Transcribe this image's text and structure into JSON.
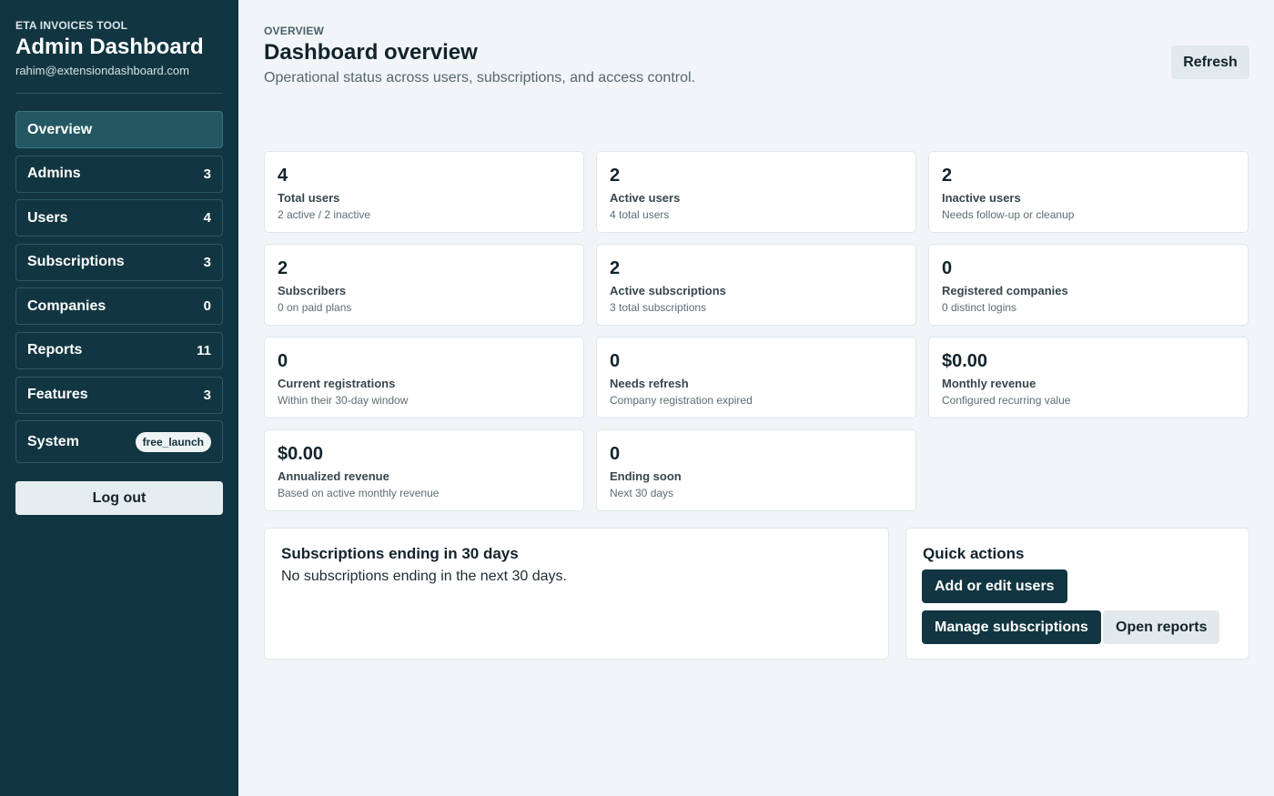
{
  "sidebar": {
    "kicker": "ETA INVOICES TOOL",
    "title": "Admin Dashboard",
    "email": "rahim@extensiondashboard.com",
    "nav": {
      "overview": {
        "label": "Overview"
      },
      "admins": {
        "label": "Admins",
        "count": "3"
      },
      "users": {
        "label": "Users",
        "count": "4"
      },
      "subscriptions": {
        "label": "Subscriptions",
        "count": "3"
      },
      "companies": {
        "label": "Companies",
        "count": "0"
      },
      "reports": {
        "label": "Reports",
        "count": "11"
      },
      "features": {
        "label": "Features",
        "count": "3"
      },
      "system": {
        "label": "System",
        "badge": "free_launch"
      }
    },
    "logout_label": "Log out"
  },
  "header": {
    "eyebrow": "OVERVIEW",
    "title": "Dashboard overview",
    "subtitle": "Operational status across users, subscriptions, and access control.",
    "refresh_label": "Refresh"
  },
  "stats": {
    "total_users": {
      "value": "4",
      "label": "Total users",
      "sub": "2 active / 2 inactive"
    },
    "active_users": {
      "value": "2",
      "label": "Active users",
      "sub": "4 total users"
    },
    "inactive_users": {
      "value": "2",
      "label": "Inactive users",
      "sub": "Needs follow-up or cleanup"
    },
    "subscribers": {
      "value": "2",
      "label": "Subscribers",
      "sub": "0 on paid plans"
    },
    "active_subscriptions": {
      "value": "2",
      "label": "Active subscriptions",
      "sub": "3 total subscriptions"
    },
    "registered_companies": {
      "value": "0",
      "label": "Registered companies",
      "sub": "0 distinct logins"
    },
    "current_registrations": {
      "value": "0",
      "label": "Current registrations",
      "sub": "Within their 30-day window"
    },
    "needs_refresh": {
      "value": "0",
      "label": "Needs refresh",
      "sub": "Company registration expired"
    },
    "monthly_revenue": {
      "value": "$0.00",
      "label": "Monthly revenue",
      "sub": "Configured recurring value"
    },
    "annualized_revenue": {
      "value": "$0.00",
      "label": "Annualized revenue",
      "sub": "Based on active monthly revenue"
    },
    "ending_soon": {
      "value": "0",
      "label": "Ending soon",
      "sub": "Next 30 days"
    }
  },
  "ending_panel": {
    "title": "Subscriptions ending in 30 days",
    "empty_text": "No subscriptions ending in the next 30 days."
  },
  "quick_actions": {
    "title": "Quick actions",
    "add_users_label": "Add or edit users",
    "manage_subscriptions_label": "Manage subscriptions",
    "open_reports_label": "Open reports"
  }
}
